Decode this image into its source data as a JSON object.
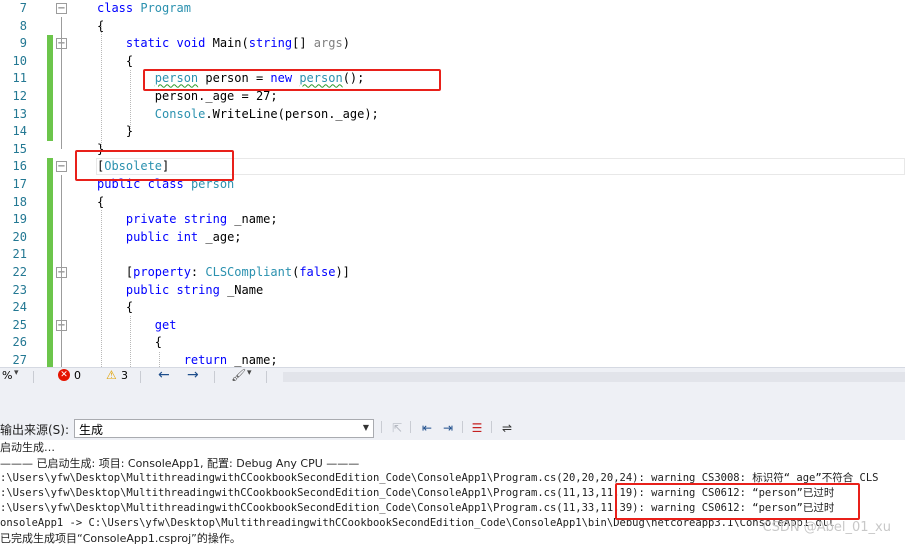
{
  "editor": {
    "lines": [
      {
        "num": "7",
        "changed": false,
        "fold": "minus",
        "segments": [
          {
            "t": "class ",
            "c": "kw"
          },
          {
            "t": "Program",
            "c": "ty"
          }
        ]
      },
      {
        "num": "8",
        "changed": false,
        "fold": "",
        "segments": [
          {
            "t": "{",
            "c": ""
          }
        ]
      },
      {
        "num": "9",
        "changed": true,
        "fold": "minus",
        "segments": [
          {
            "t": "    static ",
            "c": "kw"
          },
          {
            "t": "void ",
            "c": "kw"
          },
          {
            "t": "Main(",
            "c": ""
          },
          {
            "t": "string",
            "c": "kw"
          },
          {
            "t": "[] ",
            "c": ""
          },
          {
            "t": "args",
            "c": "gr"
          },
          {
            "t": ")",
            "c": ""
          }
        ]
      },
      {
        "num": "10",
        "changed": true,
        "fold": "",
        "segments": [
          {
            "t": "    {",
            "c": ""
          }
        ]
      },
      {
        "num": "11",
        "changed": true,
        "fold": "",
        "segments": [
          {
            "t": "        ",
            "c": ""
          },
          {
            "t": "person",
            "c": "ty sq"
          },
          {
            "t": " person = ",
            "c": ""
          },
          {
            "t": "new",
            "c": "kw"
          },
          {
            "t": " ",
            "c": ""
          },
          {
            "t": "person",
            "c": "ty sq"
          },
          {
            "t": "();",
            "c": ""
          }
        ]
      },
      {
        "num": "12",
        "changed": true,
        "fold": "",
        "segments": [
          {
            "t": "        person._age = 27;",
            "c": ""
          }
        ]
      },
      {
        "num": "13",
        "changed": true,
        "fold": "",
        "segments": [
          {
            "t": "        ",
            "c": ""
          },
          {
            "t": "Console",
            "c": "ty"
          },
          {
            "t": ".WriteLine(person._age);",
            "c": ""
          }
        ]
      },
      {
        "num": "14",
        "changed": true,
        "fold": "",
        "segments": [
          {
            "t": "    }",
            "c": ""
          }
        ]
      },
      {
        "num": "15",
        "changed": false,
        "fold": "",
        "segments": [
          {
            "t": "}",
            "c": ""
          }
        ]
      },
      {
        "num": "16",
        "changed": true,
        "fold": "minus",
        "segments": [
          {
            "t": "[",
            "c": ""
          },
          {
            "t": "Obsolete",
            "c": "ty"
          },
          {
            "t": "]",
            "c": ""
          }
        ]
      },
      {
        "num": "17",
        "changed": true,
        "fold": "",
        "segments": [
          {
            "t": "public ",
            "c": "kw"
          },
          {
            "t": "class ",
            "c": "kw"
          },
          {
            "t": "person",
            "c": "ty"
          }
        ]
      },
      {
        "num": "18",
        "changed": true,
        "fold": "",
        "segments": [
          {
            "t": "{",
            "c": ""
          }
        ]
      },
      {
        "num": "19",
        "changed": true,
        "fold": "",
        "segments": [
          {
            "t": "    private ",
            "c": "kw"
          },
          {
            "t": "string",
            "c": "kw"
          },
          {
            "t": " _name;",
            "c": ""
          }
        ]
      },
      {
        "num": "20",
        "changed": true,
        "fold": "",
        "segments": [
          {
            "t": "    public ",
            "c": "kw"
          },
          {
            "t": "int",
            "c": "kw"
          },
          {
            "t": " _age;",
            "c": ""
          }
        ]
      },
      {
        "num": "21",
        "changed": true,
        "fold": "",
        "segments": [
          {
            "t": "",
            "c": ""
          }
        ]
      },
      {
        "num": "22",
        "changed": true,
        "fold": "minus",
        "segments": [
          {
            "t": "    [",
            "c": ""
          },
          {
            "t": "property",
            "c": "kw"
          },
          {
            "t": ": ",
            "c": ""
          },
          {
            "t": "CLSCompliant",
            "c": "ty"
          },
          {
            "t": "(",
            "c": ""
          },
          {
            "t": "false",
            "c": "kw"
          },
          {
            "t": ")]",
            "c": ""
          }
        ]
      },
      {
        "num": "23",
        "changed": true,
        "fold": "",
        "segments": [
          {
            "t": "    public ",
            "c": "kw"
          },
          {
            "t": "string",
            "c": "kw"
          },
          {
            "t": " _Name",
            "c": ""
          }
        ]
      },
      {
        "num": "24",
        "changed": true,
        "fold": "",
        "segments": [
          {
            "t": "    {",
            "c": ""
          }
        ]
      },
      {
        "num": "25",
        "changed": true,
        "fold": "minus",
        "segments": [
          {
            "t": "        get",
            "c": "kw"
          }
        ]
      },
      {
        "num": "26",
        "changed": true,
        "fold": "",
        "segments": [
          {
            "t": "        {",
            "c": ""
          }
        ]
      },
      {
        "num": "27",
        "changed": true,
        "fold": "",
        "segments": [
          {
            "t": "            return",
            "c": "kw"
          },
          {
            "t": " _name;",
            "c": ""
          }
        ]
      }
    ]
  },
  "status": {
    "zoom": "%",
    "errors": "0",
    "warnings": "3",
    "back_icon": "arrow-left-icon",
    "forward_icon": "arrow-right-icon",
    "brush_icon": "brush-icon"
  },
  "output": {
    "source_label": "输出来源(S):",
    "source_value": "生成",
    "lines": [
      "启动生成…",
      "——— 已启动生成: 项目: ConsoleApp1, 配置: Debug Any CPU ———",
      ":\\Users\\yfw\\Desktop\\MultithreadingwithCCookbookSecondEdition_Code\\ConsoleApp1\\Program.cs(20,20,20,24): warning CS3008: 标识符“_age”不符合 CLS",
      ":\\Users\\yfw\\Desktop\\MultithreadingwithCCookbookSecondEdition_Code\\ConsoleApp1\\Program.cs(11,13,11,19): warning CS0612: “person”已过时",
      ":\\Users\\yfw\\Desktop\\MultithreadingwithCCookbookSecondEdition_Code\\ConsoleApp1\\Program.cs(11,33,11,39): warning CS0612: “person”已过时",
      "onsoleApp1 -> C:\\Users\\yfw\\Desktop\\MultithreadingwithCCookbookSecondEdition_Code\\ConsoleApp1\\bin\\Debug\\netcoreapp3.1\\ConsoleApp1.dll",
      "已完成生成项目“ConsoleApp1.csproj”的操作。"
    ],
    "watermark": "CSDN @Abel_01_xu"
  },
  "colors": {
    "keyword": "#0000ff",
    "type": "#2b91af",
    "highlight_box": "#e8201a",
    "change_bar": "#6cc54b"
  }
}
